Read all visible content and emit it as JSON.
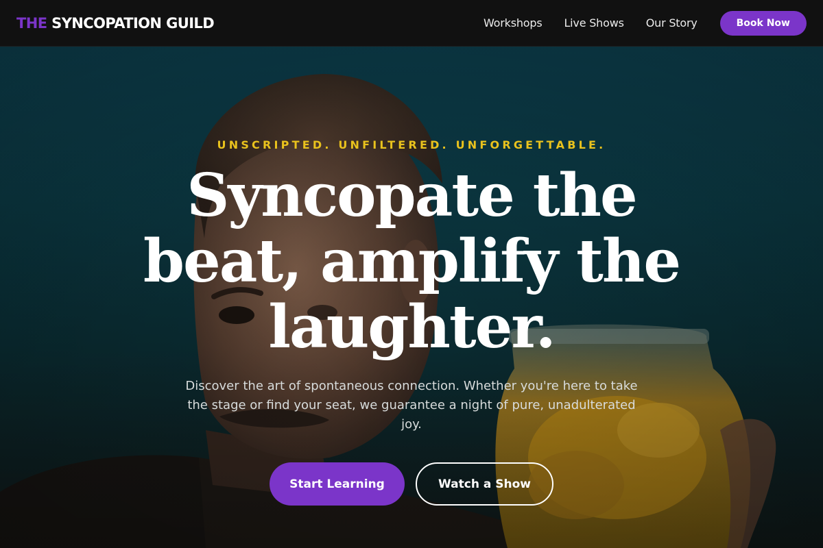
{
  "nav": {
    "logo_accent": "THE",
    "logo_text": "SYNCOPATION GUILD",
    "links": [
      {
        "label": "Workshops"
      },
      {
        "label": "Live Shows"
      },
      {
        "label": "Our Story"
      }
    ],
    "cta_label": "Book Now"
  },
  "hero": {
    "tagline": "UNSCRIPTED. UNFILTERED. UNFORGETTABLE.",
    "headline": "Syncopate the beat, amplify the laughter.",
    "subtext": "Discover the art of spontaneous connection. Whether you're here to take the stage or find your seat, we guarantee a night of pure, unadulterated joy.",
    "primary_cta": "Start Learning",
    "secondary_cta": "Watch a Show"
  },
  "colors": {
    "accent": "#7b35c9",
    "tagline": "#e9c21d",
    "nav_bg": "#111111",
    "hero_bg": "#0c3d48"
  }
}
